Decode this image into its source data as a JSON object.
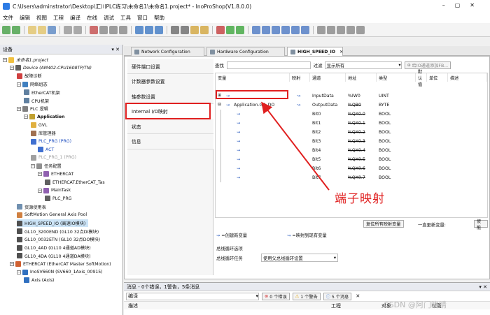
{
  "window": {
    "title": "C:\\Users\\adminstrator\\Desktop\\汇川PLC练习\\未命名1\\未命名1.project* - InoProShop(V1.8.0.0)"
  },
  "menu": [
    "文件",
    "编辑",
    "视图",
    "工程",
    "编译",
    "在线",
    "调试",
    "工具",
    "窗口",
    "帮助"
  ],
  "device_panel": {
    "title": "设备",
    "pin": "▾ ✕"
  },
  "tree": [
    {
      "label": "未命名1.project",
      "indent": 0,
      "icon": "project-icon",
      "color": "#f0c040"
    },
    {
      "label": "Device (AM402-CPU1608TP/TN)",
      "indent": 1,
      "icon": "device-icon",
      "color": "#606060"
    },
    {
      "label": "故障诊断",
      "indent": 2,
      "icon": "diag-icon",
      "color": "#d04040"
    },
    {
      "label": "网络组态",
      "indent": 2,
      "icon": "network-icon",
      "color": "#4080c0"
    },
    {
      "label": "EtherCAT机架",
      "indent": 3,
      "icon": "rack-icon",
      "color": "#6080a0"
    },
    {
      "label": "CPU机架",
      "indent": 3,
      "icon": "rack-icon",
      "color": "#6080a0"
    },
    {
      "label": "PLC 逻辑",
      "indent": 2,
      "icon": "plc-icon",
      "color": "#808080"
    },
    {
      "label": "Application",
      "indent": 3,
      "icon": "application-icon",
      "color": "#c0a030",
      "bold": true
    },
    {
      "label": "GVL",
      "indent": 4,
      "icon": "gvl-icon",
      "color": "#e0b040"
    },
    {
      "label": "库管理器",
      "indent": 4,
      "icon": "library-icon",
      "color": "#a07050"
    },
    {
      "label": "PLC_PRG (PRG)",
      "indent": 4,
      "icon": "pou-icon",
      "color": "#4070d0",
      "blue": true
    },
    {
      "label": "ACT",
      "indent": 5,
      "icon": "action-icon",
      "color": "#4070d0",
      "blue": true
    },
    {
      "label": "PLC_PRG_1 (PRG)",
      "indent": 4,
      "icon": "pou-icon",
      "color": "#a0a0a0",
      "grey": true
    },
    {
      "label": "任务配置",
      "indent": 4,
      "icon": "task-config-icon",
      "color": "#909090"
    },
    {
      "label": "ETHERCAT",
      "indent": 5,
      "icon": "task-icon",
      "color": "#9060b0"
    },
    {
      "label": "ETHERCAT.EtherCAT_Tas",
      "indent": 6,
      "icon": "task-call-icon",
      "color": "#606060"
    },
    {
      "label": "MainTask",
      "indent": 5,
      "icon": "task-icon",
      "color": "#9060b0"
    },
    {
      "label": "PLC_PRG",
      "indent": 6,
      "icon": "task-call-icon",
      "color": "#606060"
    },
    {
      "label": "资源使用表",
      "indent": 2,
      "icon": "resource-icon",
      "color": "#7090b0"
    },
    {
      "label": "SoftMotion General Axis Pool",
      "indent": 2,
      "icon": "axis-pool-icon",
      "color": "#d08040"
    },
    {
      "label": "HIGH_SPEED_IO (高速IO模块)",
      "indent": 2,
      "icon": "module-icon",
      "color": "#505050",
      "selected": true
    },
    {
      "label": "GL10_3200END (GL10 32点DI模块)",
      "indent": 2,
      "icon": "module-icon",
      "color": "#505050"
    },
    {
      "label": "GL10_0032ETN (GL10 32点DO模块)",
      "indent": 2,
      "icon": "module-icon",
      "color": "#505050"
    },
    {
      "label": "GL10_4AD (GL10 4通道AD模块)",
      "indent": 2,
      "icon": "module-icon",
      "color": "#505050"
    },
    {
      "label": "GL10_4DA (GL10 4通道DA模块)",
      "indent": 2,
      "icon": "module-icon",
      "color": "#505050"
    },
    {
      "label": "ETHERCAT (EtherCAT Master SoftMotion)",
      "indent": 1,
      "icon": "ethercat-icon",
      "color": "#d06030"
    },
    {
      "label": "InoSV660N (SV660_1Axis_00915)",
      "indent": 2,
      "icon": "servo-icon",
      "color": "#3070c0"
    },
    {
      "label": "Axis (Axis)",
      "indent": 3,
      "icon": "axis-icon",
      "color": "#3070c0"
    }
  ],
  "editor_tabs": [
    {
      "label": "Network Configuration",
      "icon": "network-config-icon"
    },
    {
      "label": "Hardware Configuration",
      "icon": "hardware-config-icon"
    },
    {
      "label": "HIGH_SPEED_IO",
      "icon": "io-module-icon",
      "active": true
    }
  ],
  "side_tabs": [
    "硬件端口设置",
    "计数器参数设置",
    "轴参数设置",
    "Internal I/O映射",
    "状态",
    "信息"
  ],
  "side_tab_active": 3,
  "filter": {
    "find_label": "查找",
    "filter_label": "过滤",
    "filter_value": "显示所有",
    "add_fb": "给IO通道添加FB..."
  },
  "columns": [
    "变量",
    "映射",
    "通道",
    "地址",
    "类型",
    "默认值",
    "单位",
    "描述"
  ],
  "rows": [
    {
      "var": "",
      "map": "",
      "channel": "InputData",
      "addr": "%IW0",
      "type": "UINT",
      "strike": false,
      "level": 0
    },
    {
      "var": "Application.GB_DO",
      "map": "",
      "channel": "OutputData",
      "addr": "%QB0",
      "type": "BYTE",
      "strike": true,
      "level": 0,
      "expanded": true
    },
    {
      "var": "",
      "channel": "Bit0",
      "addr": "%QX0.0",
      "type": "BOOL",
      "strike": true,
      "level": 1
    },
    {
      "var": "",
      "channel": "Bit1",
      "addr": "%QX0.1",
      "type": "BOOL",
      "strike": true,
      "level": 1
    },
    {
      "var": "",
      "channel": "Bit2",
      "addr": "%QX0.2",
      "type": "BOOL",
      "strike": true,
      "level": 1
    },
    {
      "var": "",
      "channel": "Bit3",
      "addr": "%QX0.3",
      "type": "BOOL",
      "strike": true,
      "level": 1
    },
    {
      "var": "",
      "channel": "Bit4",
      "addr": "%QX0.4",
      "type": "BOOL",
      "strike": true,
      "level": 1
    },
    {
      "var": "",
      "channel": "Bit5",
      "addr": "%QX0.5",
      "type": "BOOL",
      "strike": true,
      "level": 1
    },
    {
      "var": "",
      "channel": "Bit6",
      "addr": "%QX0.6",
      "type": "BOOL",
      "strike": true,
      "level": 1
    },
    {
      "var": "",
      "channel": "Bit7",
      "addr": "%QX0.7",
      "type": "BOOL",
      "strike": true,
      "level": 1
    }
  ],
  "annotation": "端子映射",
  "reset_button": "复位所有映射变量",
  "update_label": "一直更新变量:",
  "update_value": "使能",
  "legend": {
    "new_var": "=创建新变量",
    "map_existing": "=映射到现有变量"
  },
  "bus_cycle": {
    "group_label": "总线循环选项",
    "task_label": "总线循环任务",
    "task_value": "使用父总线循环设置"
  },
  "messages": {
    "title": "消息 - 0个错误，1警告，5条消息",
    "pin": "▾ ✕",
    "compile": "编译",
    "errors": "0 个错误",
    "warnings": "1 个警告",
    "infos": "5 个消息",
    "col_desc": "描述",
    "col_project": "工程",
    "col_object": "对象",
    "col_pos": "位置"
  },
  "watermark": "CSDN @阿门晓晴",
  "colors": {
    "annotation": "#e02020",
    "selected": "#cce4f7",
    "strike_red": "#c00000"
  }
}
